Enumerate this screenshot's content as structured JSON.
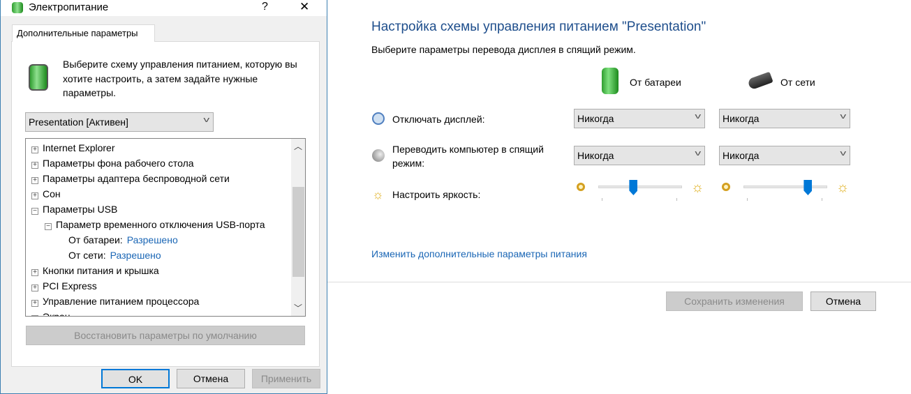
{
  "dialog": {
    "title": "Электропитание",
    "help": "?",
    "close": "✕",
    "tab": "Дополнительные параметры",
    "intro": "Выберите схему управления питанием, которую вы хотите настроить, а затем задайте нужные параметры.",
    "scheme": "Presentation [Активен]",
    "tree": [
      {
        "label": "Internet Explorer",
        "sign": "+",
        "level": 0
      },
      {
        "label": "Параметры фона рабочего стола",
        "sign": "+",
        "level": 0
      },
      {
        "label": "Параметры адаптера беспроводной сети",
        "sign": "+",
        "level": 0
      },
      {
        "label": "Сон",
        "sign": "+",
        "level": 0
      },
      {
        "label": "Параметры USB",
        "sign": "−",
        "level": 0
      },
      {
        "label": "Параметр временного отключения USB-порта",
        "sign": "−",
        "level": 1
      },
      {
        "label": "От батареи:",
        "value": "Разрешено",
        "level": 2
      },
      {
        "label": "От сети:",
        "value": "Разрешено",
        "level": 2
      },
      {
        "label": "Кнопки питания и крышка",
        "sign": "+",
        "level": 0
      },
      {
        "label": "PCI Express",
        "sign": "+",
        "level": 0
      },
      {
        "label": "Управление питанием процессора",
        "sign": "+",
        "level": 0
      },
      {
        "label": "Экран",
        "sign": "+",
        "level": 0
      }
    ],
    "restore": "Восстановить параметры по умолчанию",
    "ok": "OK",
    "cancel": "Отмена",
    "apply": "Применить"
  },
  "main": {
    "title": "Настройка схемы управления питанием \"Presentation\"",
    "subtitle": "Выберите параметры перевода дисплея в спящий режим.",
    "col_battery": "От батареи",
    "col_ac": "От сети",
    "display_label": "Отключать дисплей:",
    "sleep_label": "Переводить компьютер в спящий режим:",
    "brightness_label": "Настроить яркость:",
    "display_battery": "Никогда",
    "display_ac": "Никогда",
    "sleep_battery": "Никогда",
    "sleep_ac": "Никогда",
    "brightness_battery_pct": 42,
    "brightness_ac_pct": 77,
    "advanced_link": "Изменить дополнительные параметры питания",
    "save": "Сохранить изменения",
    "cancel": "Отмена"
  },
  "colors": {
    "accent": "#0078d7",
    "link": "#1a66b5",
    "title": "#1e4e8c"
  }
}
